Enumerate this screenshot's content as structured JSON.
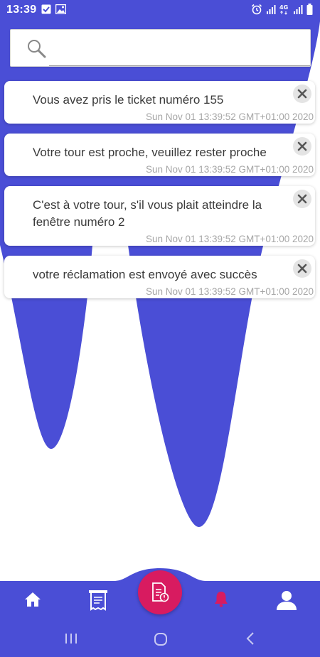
{
  "colors": {
    "primary": "#4a4ed6",
    "accent": "#d81b60",
    "card_bg": "#ffffff",
    "text": "#3a3a3a",
    "date_text": "#a6a6a6"
  },
  "status_bar": {
    "time": "13:39",
    "left_icons": [
      "checkbox-notification-icon",
      "image-notification-icon"
    ],
    "right_icons": [
      "alarm-icon",
      "signal-icon",
      "4g-icon",
      "signal-icon",
      "battery-icon"
    ],
    "network": "4G"
  },
  "search": {
    "placeholder": "",
    "value": "",
    "icon": "search-icon"
  },
  "notifications": [
    {
      "message": "Vous avez pris le ticket numéro 155",
      "date": "Sun Nov 01 13:39:52 GMT+01:00 2020"
    },
    {
      "message": "Votre tour est proche, veuillez rester proche",
      "date": "Sun Nov 01 13:39:52 GMT+01:00 2020"
    },
    {
      "message": "C'est à votre tour, s'il vous plait atteindre la fenêtre numéro 2",
      "date": "Sun Nov 01 13:39:52 GMT+01:00 2020"
    },
    {
      "message": "votre réclamation est envoyé avec succès",
      "date": "Sun Nov 01 13:39:52 GMT+01:00 2020"
    }
  ],
  "bottom_nav": {
    "items": [
      "home-icon",
      "ticket-icon",
      "complaint-icon",
      "notifications-icon",
      "profile-icon"
    ],
    "active": "notifications-icon"
  },
  "system_nav": [
    "recent-apps-icon",
    "home-circle-icon",
    "back-icon"
  ]
}
